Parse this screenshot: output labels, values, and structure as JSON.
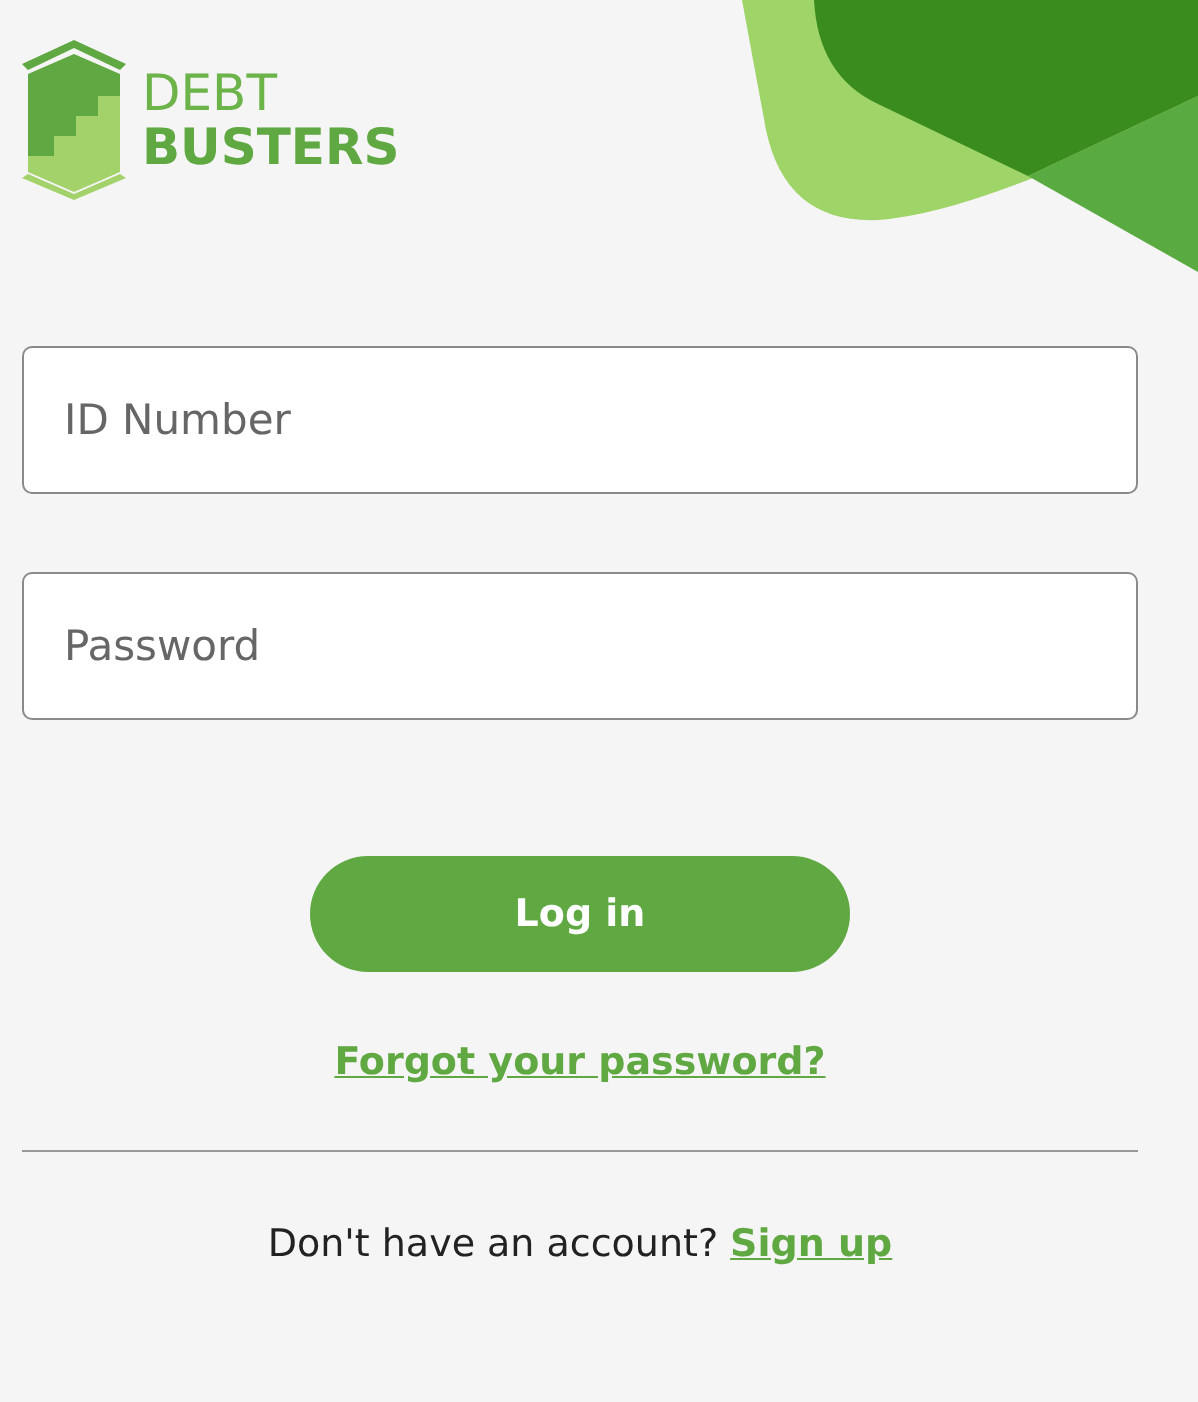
{
  "logo": {
    "line_1": "DEBT",
    "line_2": "BUSTERS"
  },
  "fields": [
    {
      "placeholder": "ID Number"
    },
    {
      "placeholder": "Password"
    }
  ],
  "login_button": "Log in",
  "forgot_link": "Forgot your password?",
  "signup": {
    "prompt": "Don't have an account?",
    "link": "Sign up"
  }
}
